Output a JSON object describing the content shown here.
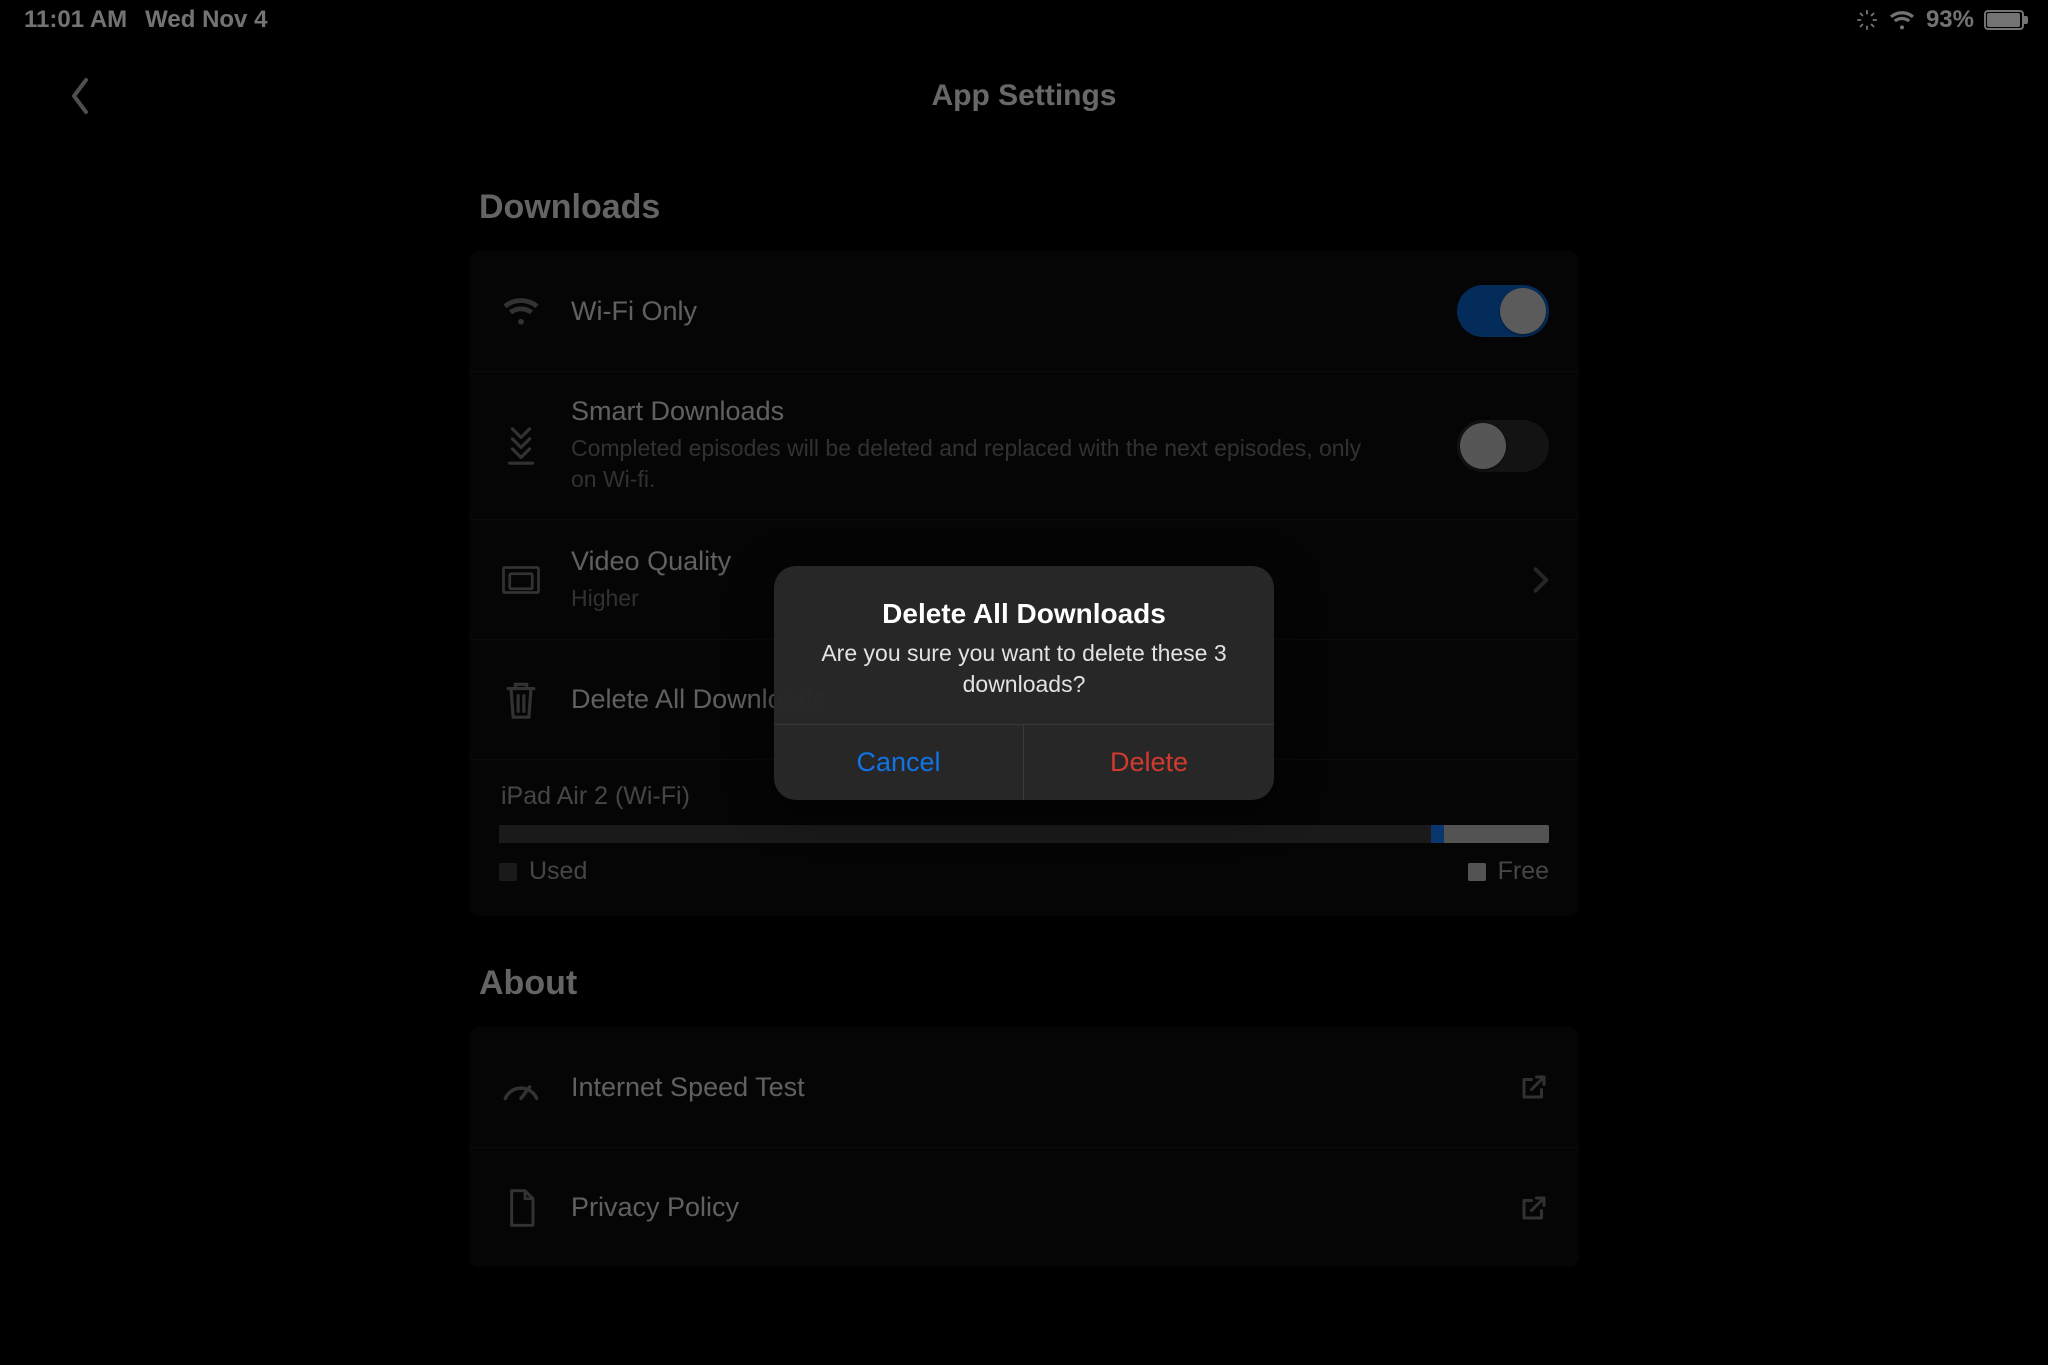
{
  "status_bar": {
    "time": "11:01 AM",
    "date": "Wed Nov 4",
    "battery_percent": "93%"
  },
  "header": {
    "title": "App Settings"
  },
  "sections": {
    "downloads": {
      "title": "Downloads",
      "wifi_only": {
        "label": "Wi-Fi Only",
        "on": true
      },
      "smart_downloads": {
        "label": "Smart Downloads",
        "sub": "Completed episodes will be deleted and replaced with the next episodes, only on Wi-fi.",
        "on": false
      },
      "video_quality": {
        "label": "Video Quality",
        "value": "Higher"
      },
      "delete_all": {
        "label": "Delete All Downloads"
      },
      "storage": {
        "device": "iPad Air 2 (Wi-Fi)",
        "used_pct": 90,
        "app_pct": 1.2,
        "legend_used": "Used",
        "legend_free": "Free",
        "used_color": "#3a3a3a",
        "free_color": "#b9b9b9"
      }
    },
    "about": {
      "title": "About",
      "speed_test": "Internet Speed Test",
      "privacy": "Privacy Policy"
    }
  },
  "alert": {
    "title": "Delete All Downloads",
    "message": "Are you sure you want to delete these 3 downloads?",
    "cancel": "Cancel",
    "delete": "Delete"
  }
}
